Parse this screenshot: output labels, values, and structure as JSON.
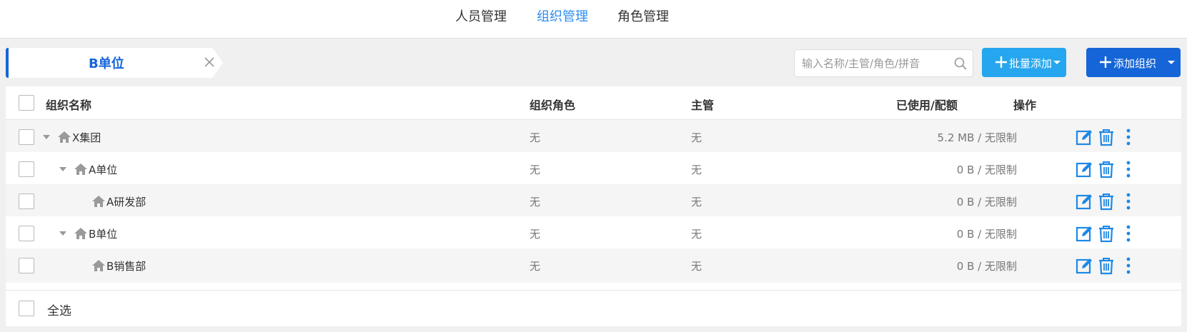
{
  "nav": {
    "tabs": [
      {
        "label": "人员管理",
        "active": false
      },
      {
        "label": "组织管理",
        "active": true
      },
      {
        "label": "角色管理",
        "active": false
      }
    ]
  },
  "breadcrumb": {
    "label": "B单位",
    "close_icon": "close-icon"
  },
  "search": {
    "placeholder": "输入名称/主管/角色/拼音",
    "value": "",
    "icon": "search-icon"
  },
  "toolbar": {
    "batch_add_label": "批量添加",
    "add_org_label": "添加组织",
    "accent": "#1565d8",
    "batch_color": "#26a6ee"
  },
  "table": {
    "headers": {
      "name": "组织名称",
      "role": "组织角色",
      "manager": "主管",
      "usage": "已使用/配额",
      "ops": "操作"
    },
    "rows": [
      {
        "name": "X集团",
        "expandable": true,
        "role": "无",
        "manager": "无",
        "usage": "5.2 MB / 无限制"
      },
      {
        "name": "A单位",
        "expandable": true,
        "role": "无",
        "manager": "无",
        "usage": "0 B / 无限制"
      },
      {
        "name": "A研发部",
        "expandable": false,
        "role": "无",
        "manager": "无",
        "usage": "0 B / 无限制"
      },
      {
        "name": "B单位",
        "expandable": true,
        "role": "无",
        "manager": "无",
        "usage": "0 B / 无限制"
      },
      {
        "name": "B销售部",
        "expandable": false,
        "role": "无",
        "manager": "无",
        "usage": "0 B / 无限制"
      }
    ],
    "select_all_label": "全选",
    "icons": {
      "edit": "edit-icon",
      "delete": "trash-icon",
      "more": "more-vertical-icon",
      "home": "home-icon"
    },
    "action_color": "#1e88e5"
  }
}
